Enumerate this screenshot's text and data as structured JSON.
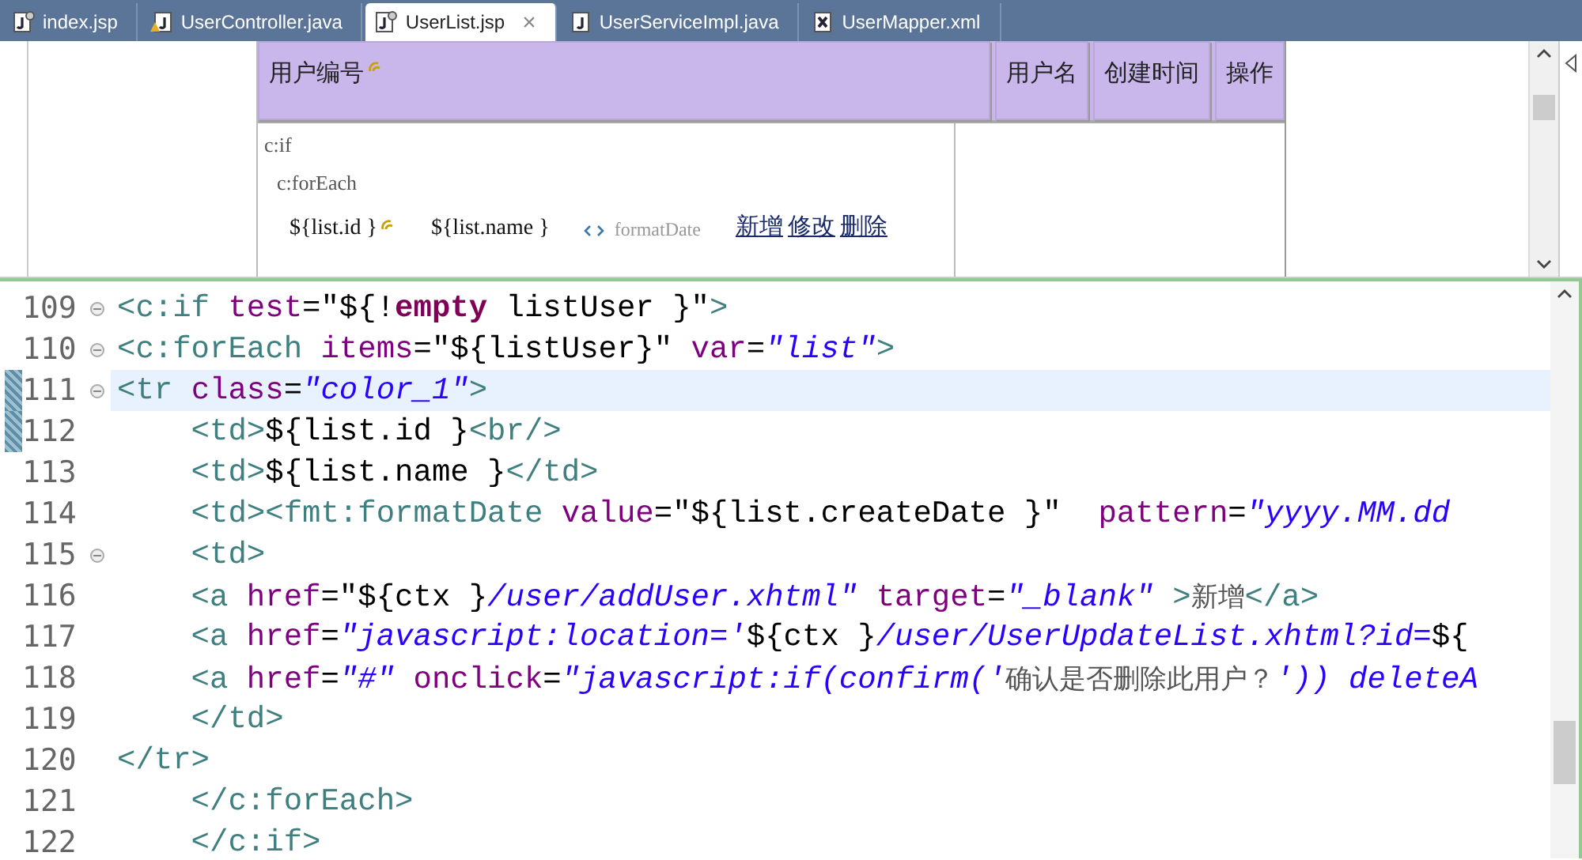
{
  "tabs": [
    {
      "label": "index.jsp",
      "kind": "jsp",
      "selected": false,
      "closable": false
    },
    {
      "label": "UserController.java",
      "kind": "java-warn",
      "selected": false,
      "closable": false
    },
    {
      "label": "UserList.jsp",
      "kind": "jsp",
      "selected": true,
      "closable": true
    },
    {
      "label": "UserServiceImpl.java",
      "kind": "java",
      "selected": false,
      "closable": false
    },
    {
      "label": "UserMapper.xml",
      "kind": "xml",
      "selected": false,
      "closable": false
    }
  ],
  "close_glyph": "×",
  "design": {
    "header": [
      {
        "label": "用户编号",
        "marker": true
      },
      {
        "label": "用户名",
        "marker": false
      },
      {
        "label": "创建时间",
        "marker": false
      },
      {
        "label": "操作",
        "marker": false
      }
    ],
    "tags": [
      "c:if",
      "c:forEach"
    ],
    "cells": [
      {
        "kind": "text",
        "text": "${list.id }",
        "marker": true
      },
      {
        "kind": "text",
        "text": "${list.name }",
        "marker": false
      },
      {
        "kind": "tag",
        "text": "formatDate"
      },
      {
        "kind": "links",
        "links": [
          "新增",
          "修改",
          "删除"
        ]
      }
    ]
  },
  "editor": {
    "lines": [
      {
        "number": "109",
        "fold": true,
        "changed": false,
        "selected": false,
        "tokens": [
          {
            "kind": "tag",
            "t": "<c:if "
          },
          {
            "kind": "attr",
            "t": "test"
          },
          {
            "kind": "plain",
            "t": "=\"${!"
          },
          {
            "kind": "kw",
            "t": "empty"
          },
          {
            "kind": "plain",
            "t": " listUser }\""
          },
          {
            "kind": "tag",
            "t": ">"
          }
        ]
      },
      {
        "number": "110",
        "fold": true,
        "changed": false,
        "selected": false,
        "tokens": [
          {
            "kind": "tag",
            "t": "<c:forEach "
          },
          {
            "kind": "attr",
            "t": "items"
          },
          {
            "kind": "plain",
            "t": "=\"${listUser}\" "
          },
          {
            "kind": "attr",
            "t": "var"
          },
          {
            "kind": "plain",
            "t": "="
          },
          {
            "kind": "str",
            "t": "\"list\""
          },
          {
            "kind": "tag",
            "t": ">"
          }
        ]
      },
      {
        "number": "111",
        "fold": true,
        "changed": true,
        "selected": true,
        "tokens": [
          {
            "kind": "tag",
            "t": "<tr "
          },
          {
            "kind": "attr",
            "t": "class"
          },
          {
            "kind": "plain",
            "t": "="
          },
          {
            "kind": "str",
            "t": "\"color_1\""
          },
          {
            "kind": "tag",
            "t": ">"
          }
        ]
      },
      {
        "number": "112",
        "fold": false,
        "changed": true,
        "selected": false,
        "tokens": [
          {
            "kind": "tag",
            "t": "    <td>"
          },
          {
            "kind": "plain",
            "t": "${list.id }"
          },
          {
            "kind": "tag",
            "t": "<br/>"
          }
        ]
      },
      {
        "number": "113",
        "fold": false,
        "changed": false,
        "selected": false,
        "tokens": [
          {
            "kind": "tag",
            "t": "    <td>"
          },
          {
            "kind": "plain",
            "t": "${list.name }"
          },
          {
            "kind": "tag",
            "t": "</td>"
          }
        ]
      },
      {
        "number": "114",
        "fold": false,
        "changed": false,
        "selected": false,
        "tokens": [
          {
            "kind": "tag",
            "t": "    <td><fmt:formatDate "
          },
          {
            "kind": "attr",
            "t": "value"
          },
          {
            "kind": "plain",
            "t": "=\"${list.createDate }\"  "
          },
          {
            "kind": "attr",
            "t": "pattern"
          },
          {
            "kind": "plain",
            "t": "="
          },
          {
            "kind": "str",
            "t": "\"yyyy.MM.dd"
          }
        ]
      },
      {
        "number": "115",
        "fold": true,
        "changed": false,
        "selected": false,
        "tokens": [
          {
            "kind": "tag",
            "t": "    <td>"
          }
        ]
      },
      {
        "number": "116",
        "fold": false,
        "changed": false,
        "selected": false,
        "tokens": [
          {
            "kind": "tag",
            "t": "    <a "
          },
          {
            "kind": "attr",
            "t": "href"
          },
          {
            "kind": "plain",
            "t": "=\"${ctx }"
          },
          {
            "kind": "str",
            "t": "/user/addUser.xhtml\" "
          },
          {
            "kind": "attr",
            "t": "target"
          },
          {
            "kind": "plain",
            "t": "="
          },
          {
            "kind": "str",
            "t": "\"_blank\" "
          },
          {
            "kind": "tag",
            "t": ">"
          },
          {
            "kind": "cn",
            "t": "新增"
          },
          {
            "kind": "tag",
            "t": "</a>"
          }
        ]
      },
      {
        "number": "117",
        "fold": false,
        "changed": false,
        "selected": false,
        "tokens": [
          {
            "kind": "tag",
            "t": "    <a "
          },
          {
            "kind": "attr",
            "t": "href"
          },
          {
            "kind": "plain",
            "t": "="
          },
          {
            "kind": "str",
            "t": "\"javascript:location='"
          },
          {
            "kind": "plain",
            "t": "${ctx }"
          },
          {
            "kind": "str",
            "t": "/user/UserUpdateList.xhtml?id="
          },
          {
            "kind": "plain",
            "t": "${"
          }
        ]
      },
      {
        "number": "118",
        "fold": false,
        "changed": false,
        "selected": false,
        "tokens": [
          {
            "kind": "tag",
            "t": "    <a "
          },
          {
            "kind": "attr",
            "t": "href"
          },
          {
            "kind": "plain",
            "t": "="
          },
          {
            "kind": "str",
            "t": "\"#\" "
          },
          {
            "kind": "attr",
            "t": "onclick"
          },
          {
            "kind": "plain",
            "t": "="
          },
          {
            "kind": "str",
            "t": "\"javascript:if(confirm('"
          },
          {
            "kind": "cn",
            "t": "确认是否删除此用户？"
          },
          {
            "kind": "str",
            "t": "')) deleteA"
          }
        ]
      },
      {
        "number": "119",
        "fold": false,
        "changed": false,
        "selected": false,
        "tokens": [
          {
            "kind": "tag",
            "t": "    </td>"
          }
        ]
      },
      {
        "number": "120",
        "fold": false,
        "changed": false,
        "selected": false,
        "tokens": [
          {
            "kind": "tag",
            "t": "</tr>"
          }
        ]
      },
      {
        "number": "121",
        "fold": false,
        "changed": false,
        "selected": false,
        "tokens": [
          {
            "kind": "tag",
            "t": "    </c:forEach>"
          }
        ]
      },
      {
        "number": "122",
        "fold": false,
        "changed": false,
        "selected": false,
        "tokens": [
          {
            "kind": "tag",
            "t": "    </c:if>"
          }
        ]
      }
    ]
  }
}
